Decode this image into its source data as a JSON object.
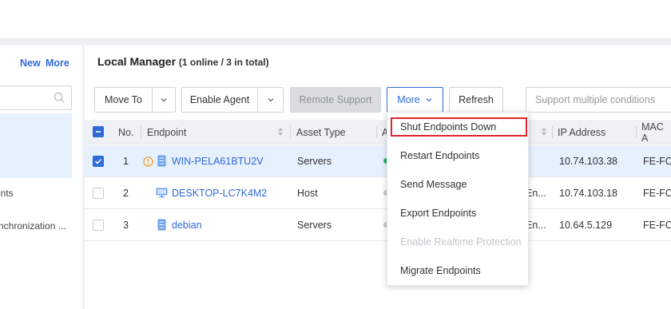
{
  "left": {
    "new_label": "New",
    "more_label": "More",
    "items": [
      "ints",
      "nchronization ..."
    ]
  },
  "main": {
    "title": "Local Manager",
    "subtitle": "(1 online / 3 in total)"
  },
  "toolbar": {
    "move_to": "Move To",
    "enable_agent": "Enable Agent",
    "remote_support": "Remote Support",
    "more": "More",
    "refresh": "Refresh",
    "search_placeholder": "Support multiple conditions"
  },
  "table": {
    "headers": {
      "no": "No.",
      "endpoint": "Endpoint",
      "asset_type": "Asset Type",
      "agent": "A",
      "ip": "IP Address",
      "mac": "MAC A"
    },
    "rows": [
      {
        "no": "1",
        "endpoint": "WIN-PELA61BTU2V",
        "asset_type": "Servers",
        "group": "",
        "ip": "10.74.103.38",
        "mac": "FE-FC",
        "selected": true,
        "status_color": "#22b36b",
        "icon": "server-icon"
      },
      {
        "no": "2",
        "endpoint": "DESKTOP-LC7K4M2",
        "asset_type": "Host",
        "group": "En...",
        "ip": "10.74.103.18",
        "mac": "FE-FC",
        "selected": false,
        "status_color": "#c5c8cc",
        "icon": "monitor-icon"
      },
      {
        "no": "3",
        "endpoint": "debian",
        "asset_type": "Servers",
        "group": "En...",
        "ip": "10.64.5.129",
        "mac": "FE-FC",
        "selected": false,
        "status_color": "#c5c8cc",
        "icon": "server-icon"
      }
    ]
  },
  "more_menu": {
    "items": [
      {
        "label": "Shut Endpoints Down",
        "disabled": false,
        "highlighted": true
      },
      {
        "label": "Restart Endpoints",
        "disabled": false
      },
      {
        "label": "Send Message",
        "disabled": false
      },
      {
        "label": "Export Endpoints",
        "disabled": false
      },
      {
        "label": "Enable Realtime Protection",
        "disabled": true
      },
      {
        "label": "Migrate Endpoints",
        "disabled": false
      }
    ]
  },
  "colors": {
    "accent": "#2f6ad9",
    "highlight_border": "#e0242b",
    "warning": "#f0a020",
    "online": "#22b36b"
  }
}
